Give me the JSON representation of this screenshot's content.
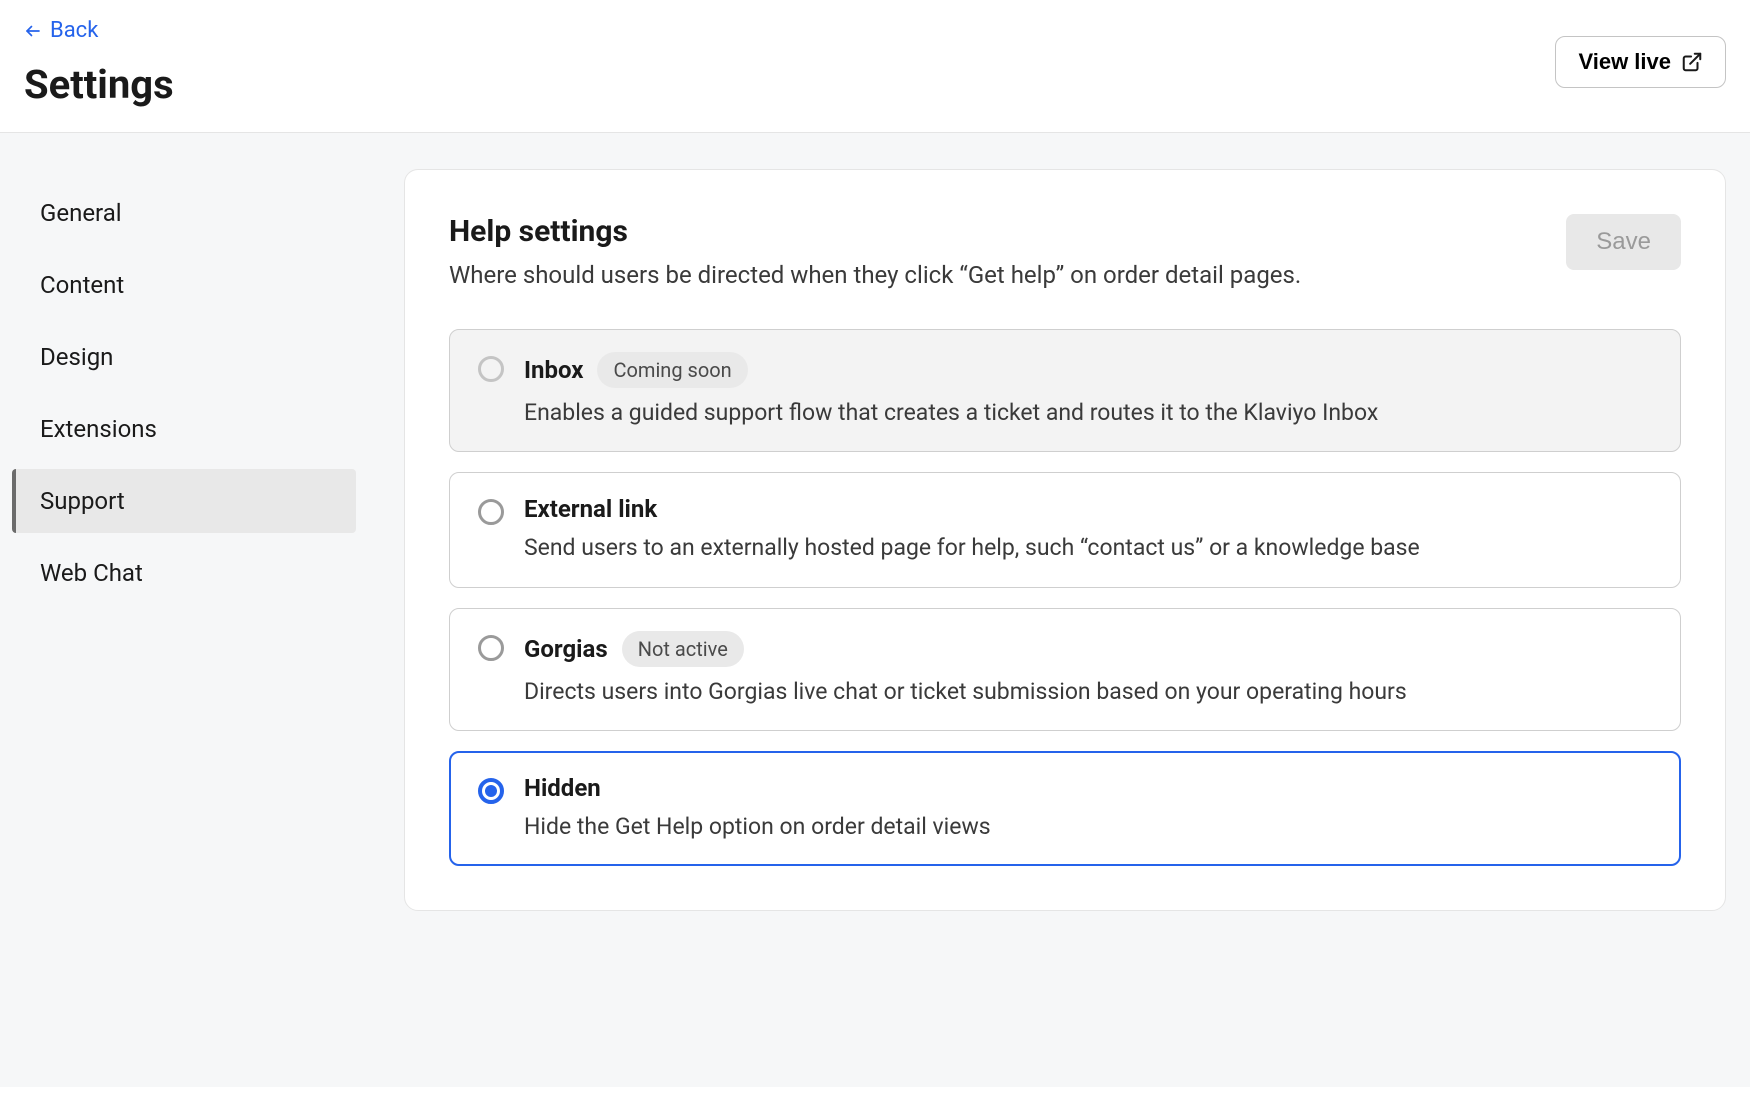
{
  "header": {
    "back_label": "Back",
    "title": "Settings",
    "view_live_label": "View live"
  },
  "sidebar": {
    "items": [
      {
        "label": "General",
        "active": false
      },
      {
        "label": "Content",
        "active": false
      },
      {
        "label": "Design",
        "active": false
      },
      {
        "label": "Extensions",
        "active": false
      },
      {
        "label": "Support",
        "active": true
      },
      {
        "label": "Web Chat",
        "active": false
      }
    ]
  },
  "main": {
    "section_title": "Help settings",
    "section_subtitle": "Where should users be directed when they click “Get help” on order detail pages.",
    "save_label": "Save",
    "options": [
      {
        "id": "inbox",
        "title": "Inbox",
        "badge": "Coming soon",
        "desc": "Enables a guided support flow that creates a ticket and routes it to the Klaviyo Inbox",
        "disabled": true,
        "selected": false
      },
      {
        "id": "external",
        "title": "External link",
        "badge": null,
        "desc": "Send users to an externally hosted page for help, such “contact us” or a knowledge base",
        "disabled": false,
        "selected": false
      },
      {
        "id": "gorgias",
        "title": "Gorgias",
        "badge": "Not active",
        "desc": "Directs users into Gorgias live chat or ticket submission based on your operating hours",
        "disabled": false,
        "selected": false
      },
      {
        "id": "hidden",
        "title": "Hidden",
        "badge": null,
        "desc": "Hide the Get Help option on order detail views",
        "disabled": false,
        "selected": true
      }
    ]
  }
}
